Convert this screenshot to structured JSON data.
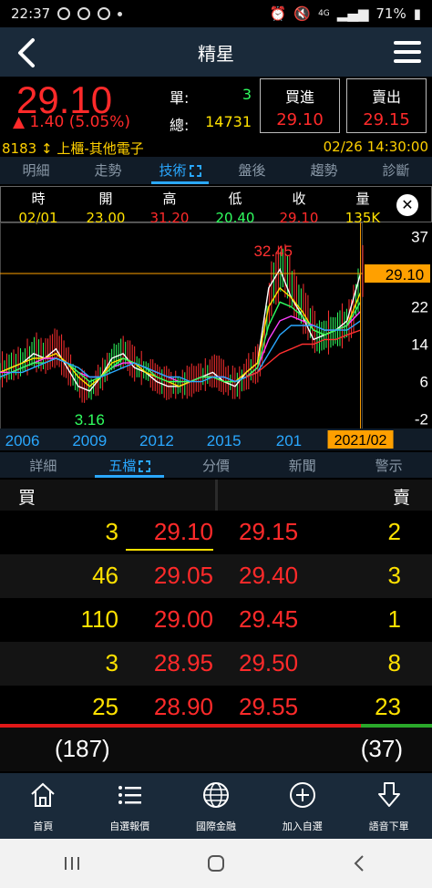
{
  "statusbar": {
    "time": "22:37",
    "battery": "71%",
    "network": "4G"
  },
  "header": {
    "title": "精星"
  },
  "quote": {
    "price": "29.10",
    "change": "▲ 1.40 (5.05%)",
    "single_label": "單:",
    "single_value": "3",
    "total_label": "總:",
    "total_value": "14731",
    "bid_label": "買進",
    "bid_value": "29.10",
    "ask_label": "賣出",
    "ask_value": "29.15",
    "code": "8183",
    "market": "上櫃-其他電子",
    "datetime": "02/26 14:30:00"
  },
  "tabs_top": [
    {
      "label": "明細"
    },
    {
      "label": "走勢"
    },
    {
      "label": "技術"
    },
    {
      "label": "盤後"
    },
    {
      "label": "趨勢"
    },
    {
      "label": "診斷"
    }
  ],
  "ohlc": {
    "headers": [
      "時",
      "開",
      "高",
      "低",
      "收",
      "量"
    ],
    "values": [
      "02/01",
      "23.00",
      "31.20",
      "20.40",
      "29.10",
      "135K"
    ]
  },
  "chart_data": {
    "type": "line",
    "title": "",
    "x_ticks": [
      "2006",
      "2009",
      "2012",
      "2015",
      "201",
      "2021/02"
    ],
    "y_ticks": [
      37,
      22,
      14,
      6,
      -2
    ],
    "current_price_label": "29.10",
    "high_annotation": "32.45",
    "low_annotation": "3.16",
    "x": [
      2005.0,
      2005.5,
      2006.0,
      2006.5,
      2007.0,
      2007.5,
      2008.0,
      2008.5,
      2009.0,
      2009.5,
      2010.0,
      2010.5,
      2011.0,
      2011.5,
      2012.0,
      2012.5,
      2013.0,
      2013.5,
      2014.0,
      2014.5,
      2015.0,
      2015.5,
      2016.0,
      2016.5,
      2017.0,
      2017.5,
      2018.0,
      2018.5,
      2019.0,
      2019.5,
      2020.0,
      2020.5,
      2021.1
    ],
    "series": [
      {
        "color": "#ffffff",
        "values": [
          8,
          9,
          10,
          12,
          11,
          13,
          9,
          5,
          4,
          7,
          11,
          12,
          9,
          8,
          6,
          5,
          5,
          6,
          7,
          8,
          6,
          5,
          8,
          10,
          26,
          30,
          24,
          20,
          15,
          16,
          17,
          19,
          29
        ]
      },
      {
        "color": "#ffe100",
        "values": [
          8,
          9,
          10,
          11,
          11,
          12,
          10,
          7,
          5,
          7,
          10,
          11,
          10,
          8,
          7,
          6,
          5,
          6,
          7,
          7,
          6,
          6,
          8,
          10,
          22,
          26,
          24,
          21,
          17,
          16,
          17,
          18,
          25
        ]
      },
      {
        "color": "#ff40ff",
        "values": [
          8,
          8,
          9,
          10,
          11,
          11,
          10,
          8,
          7,
          7,
          9,
          10,
          10,
          9,
          8,
          7,
          6,
          6,
          7,
          7,
          7,
          6,
          7,
          9,
          15,
          19,
          20,
          19,
          18,
          17,
          17,
          18,
          21
        ]
      },
      {
        "color": "#30ff60",
        "values": [
          7,
          8,
          9,
          10,
          10,
          11,
          10,
          8,
          6,
          7,
          9,
          11,
          10,
          9,
          7,
          6,
          6,
          6,
          7,
          7,
          6,
          6,
          7,
          9,
          18,
          23,
          22,
          20,
          17,
          16,
          17,
          18,
          23
        ]
      },
      {
        "color": "#2aa8ff",
        "values": [
          7,
          8,
          8,
          9,
          10,
          11,
          10,
          9,
          7,
          7,
          8,
          9,
          10,
          9,
          8,
          7,
          7,
          6,
          6,
          7,
          7,
          6,
          7,
          8,
          12,
          16,
          18,
          18,
          18,
          17,
          17,
          17,
          19
        ]
      },
      {
        "color": "#ff3030",
        "values": [
          null,
          null,
          null,
          null,
          null,
          null,
          null,
          null,
          null,
          null,
          null,
          null,
          null,
          null,
          null,
          null,
          null,
          null,
          null,
          null,
          null,
          null,
          7,
          8,
          10,
          12,
          13,
          14,
          14,
          15,
          15,
          16,
          17
        ]
      }
    ],
    "ylim": [
      -4,
      40
    ],
    "xlim": [
      2005.0,
      2021.2
    ],
    "current_price": 29.1,
    "high": 32.45,
    "low": 3.16
  },
  "tabs_bottom": [
    {
      "label": "詳細"
    },
    {
      "label": "五檔"
    },
    {
      "label": "分價"
    },
    {
      "label": "新聞"
    },
    {
      "label": "警示"
    }
  ],
  "book": {
    "buy_label": "買",
    "sell_label": "賣",
    "rows": [
      {
        "bid_qty": "3",
        "bid_price": "29.10",
        "ask_price": "29.15",
        "ask_qty": "2"
      },
      {
        "bid_qty": "46",
        "bid_price": "29.05",
        "ask_price": "29.40",
        "ask_qty": "3"
      },
      {
        "bid_qty": "110",
        "bid_price": "29.00",
        "ask_price": "29.45",
        "ask_qty": "1"
      },
      {
        "bid_qty": "3",
        "bid_price": "28.95",
        "ask_price": "29.50",
        "ask_qty": "8"
      },
      {
        "bid_qty": "25",
        "bid_price": "28.90",
        "ask_price": "29.55",
        "ask_qty": "23"
      }
    ],
    "bid_total": "(187)",
    "ask_total": "(37)",
    "bid_ratio": 0.835
  },
  "bottom_nav": [
    {
      "label": "首頁",
      "icon": "home-icon"
    },
    {
      "label": "自選報價",
      "icon": "list-icon"
    },
    {
      "label": "國際金融",
      "icon": "globe-icon"
    },
    {
      "label": "加入自選",
      "icon": "add-circle-icon"
    },
    {
      "label": "語音下單",
      "icon": "download-arrow-icon"
    }
  ]
}
